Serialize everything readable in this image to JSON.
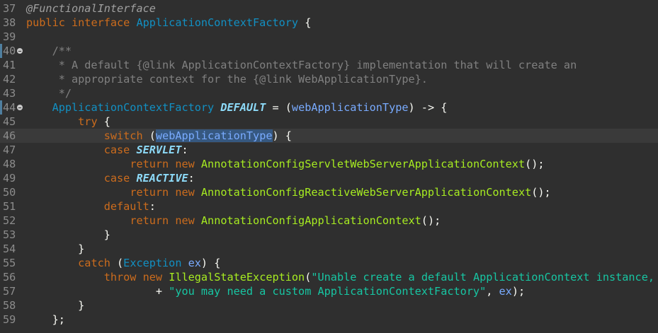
{
  "editor": {
    "lines": [
      {
        "n": "37",
        "t": [
          {
            "c": "ann",
            "s": "@FunctionalInterface"
          }
        ]
      },
      {
        "n": "38",
        "t": [
          {
            "c": "kw",
            "s": "public "
          },
          {
            "c": "kw",
            "s": "interface "
          },
          {
            "c": "type",
            "s": "ApplicationContextFactory"
          },
          {
            "c": "plain",
            "s": " {"
          }
        ]
      },
      {
        "n": "39",
        "t": []
      },
      {
        "n": "40",
        "fold": true,
        "t": [
          {
            "c": "cmt",
            "s": "    /**"
          }
        ]
      },
      {
        "n": "41",
        "t": [
          {
            "c": "cmt",
            "s": "     * A default {@link ApplicationContextFactory} implementation that will create an"
          }
        ]
      },
      {
        "n": "42",
        "t": [
          {
            "c": "cmt",
            "s": "     * appropriate context for the {@link WebApplicationType}."
          }
        ]
      },
      {
        "n": "43",
        "t": [
          {
            "c": "cmt",
            "s": "     */"
          }
        ]
      },
      {
        "n": "44",
        "fold": true,
        "t": [
          {
            "c": "plain",
            "s": "    "
          },
          {
            "c": "type",
            "s": "ApplicationContextFactory "
          },
          {
            "c": "const",
            "s": "DEFAULT"
          },
          {
            "c": "plain",
            "s": " = ("
          },
          {
            "c": "param",
            "s": "webApplicationType"
          },
          {
            "c": "plain",
            "s": ") -> {"
          }
        ]
      },
      {
        "n": "45",
        "t": [
          {
            "c": "plain",
            "s": "        "
          },
          {
            "c": "kw",
            "s": "try"
          },
          {
            "c": "plain",
            "s": " {"
          }
        ]
      },
      {
        "n": "46",
        "current": true,
        "t": [
          {
            "c": "plain",
            "s": "            "
          },
          {
            "c": "kw",
            "s": "switch"
          },
          {
            "c": "plain",
            "s": " ("
          },
          {
            "c": "sel",
            "s": "webApplicationType"
          },
          {
            "c": "plain",
            "s": ") {"
          }
        ]
      },
      {
        "n": "47",
        "t": [
          {
            "c": "plain",
            "s": "            "
          },
          {
            "c": "kw",
            "s": "case "
          },
          {
            "c": "const",
            "s": "SERVLET"
          },
          {
            "c": "plain",
            "s": ":"
          }
        ]
      },
      {
        "n": "48",
        "t": [
          {
            "c": "plain",
            "s": "                "
          },
          {
            "c": "kw",
            "s": "return "
          },
          {
            "c": "kw",
            "s": "new "
          },
          {
            "c": "method",
            "s": "AnnotationConfigServletWebServerApplicationContext"
          },
          {
            "c": "plain",
            "s": "();"
          }
        ]
      },
      {
        "n": "49",
        "t": [
          {
            "c": "plain",
            "s": "            "
          },
          {
            "c": "kw",
            "s": "case "
          },
          {
            "c": "const",
            "s": "REACTIVE"
          },
          {
            "c": "plain",
            "s": ":"
          }
        ]
      },
      {
        "n": "50",
        "t": [
          {
            "c": "plain",
            "s": "                "
          },
          {
            "c": "kw",
            "s": "return "
          },
          {
            "c": "kw",
            "s": "new "
          },
          {
            "c": "method",
            "s": "AnnotationConfigReactiveWebServerApplicationContext"
          },
          {
            "c": "plain",
            "s": "();"
          }
        ]
      },
      {
        "n": "51",
        "t": [
          {
            "c": "plain",
            "s": "            "
          },
          {
            "c": "kw",
            "s": "default"
          },
          {
            "c": "plain",
            "s": ":"
          }
        ]
      },
      {
        "n": "52",
        "t": [
          {
            "c": "plain",
            "s": "                "
          },
          {
            "c": "kw",
            "s": "return "
          },
          {
            "c": "kw",
            "s": "new "
          },
          {
            "c": "method",
            "s": "AnnotationConfigApplicationContext"
          },
          {
            "c": "plain",
            "s": "();"
          }
        ]
      },
      {
        "n": "53",
        "t": [
          {
            "c": "plain",
            "s": "            }"
          }
        ]
      },
      {
        "n": "54",
        "t": [
          {
            "c": "plain",
            "s": "        }"
          }
        ]
      },
      {
        "n": "55",
        "t": [
          {
            "c": "plain",
            "s": "        "
          },
          {
            "c": "kw",
            "s": "catch"
          },
          {
            "c": "plain",
            "s": " ("
          },
          {
            "c": "type",
            "s": "Exception "
          },
          {
            "c": "param",
            "s": "ex"
          },
          {
            "c": "plain",
            "s": ") {"
          }
        ]
      },
      {
        "n": "56",
        "t": [
          {
            "c": "plain",
            "s": "            "
          },
          {
            "c": "kw",
            "s": "throw "
          },
          {
            "c": "kw",
            "s": "new "
          },
          {
            "c": "method",
            "s": "IllegalStateException"
          },
          {
            "c": "plain",
            "s": "("
          },
          {
            "c": "str",
            "s": "\"Unable create a default ApplicationContext instance, \""
          }
        ]
      },
      {
        "n": "57",
        "t": [
          {
            "c": "plain",
            "s": "                    + "
          },
          {
            "c": "str",
            "s": "\"you may need a custom ApplicationContextFactory\""
          },
          {
            "c": "plain",
            "s": ", "
          },
          {
            "c": "param",
            "s": "ex"
          },
          {
            "c": "plain",
            "s": ");"
          }
        ]
      },
      {
        "n": "58",
        "t": [
          {
            "c": "plain",
            "s": "        }"
          }
        ]
      },
      {
        "n": "59",
        "t": [
          {
            "c": "plain",
            "s": "    };"
          }
        ]
      }
    ]
  }
}
